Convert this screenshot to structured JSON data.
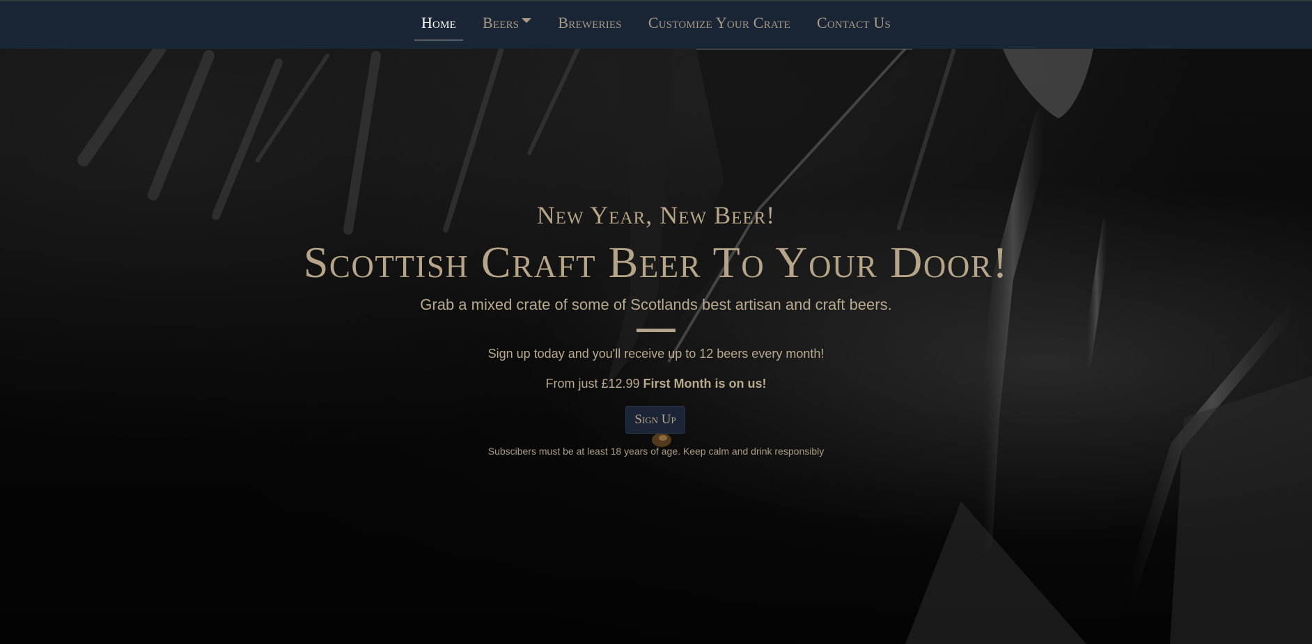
{
  "nav": {
    "items": [
      {
        "label": "Home",
        "active": true
      },
      {
        "label": "Beers",
        "dropdown": true
      },
      {
        "label": "Breweries"
      },
      {
        "label": "Customize Your Crate"
      },
      {
        "label": "Contact Us"
      }
    ]
  },
  "hero": {
    "eyebrow": "New Year, New Beer!",
    "headline": "Scottish Craft Beer To Your Door!",
    "lead": "Grab a mixed crate of some of Scotlands best artisan and craft beers.",
    "signup_text": "Sign up today and you'll receive up to 12 beers every month!",
    "price_prefix": "From just £12.99",
    "price_highlight": "First Month is on us!",
    "cta_label": "Sign Up",
    "disclaimer": "Subscibers must be at least 18 years of age. Keep calm and drink responsibly"
  },
  "colors": {
    "navbar_bg": "#1a2536",
    "accent_tan": "#b7a58a",
    "nav_active": "#ffffff",
    "button_bg": "#1b2537"
  },
  "icons": {
    "beers_dropdown": "caret-down-icon"
  }
}
